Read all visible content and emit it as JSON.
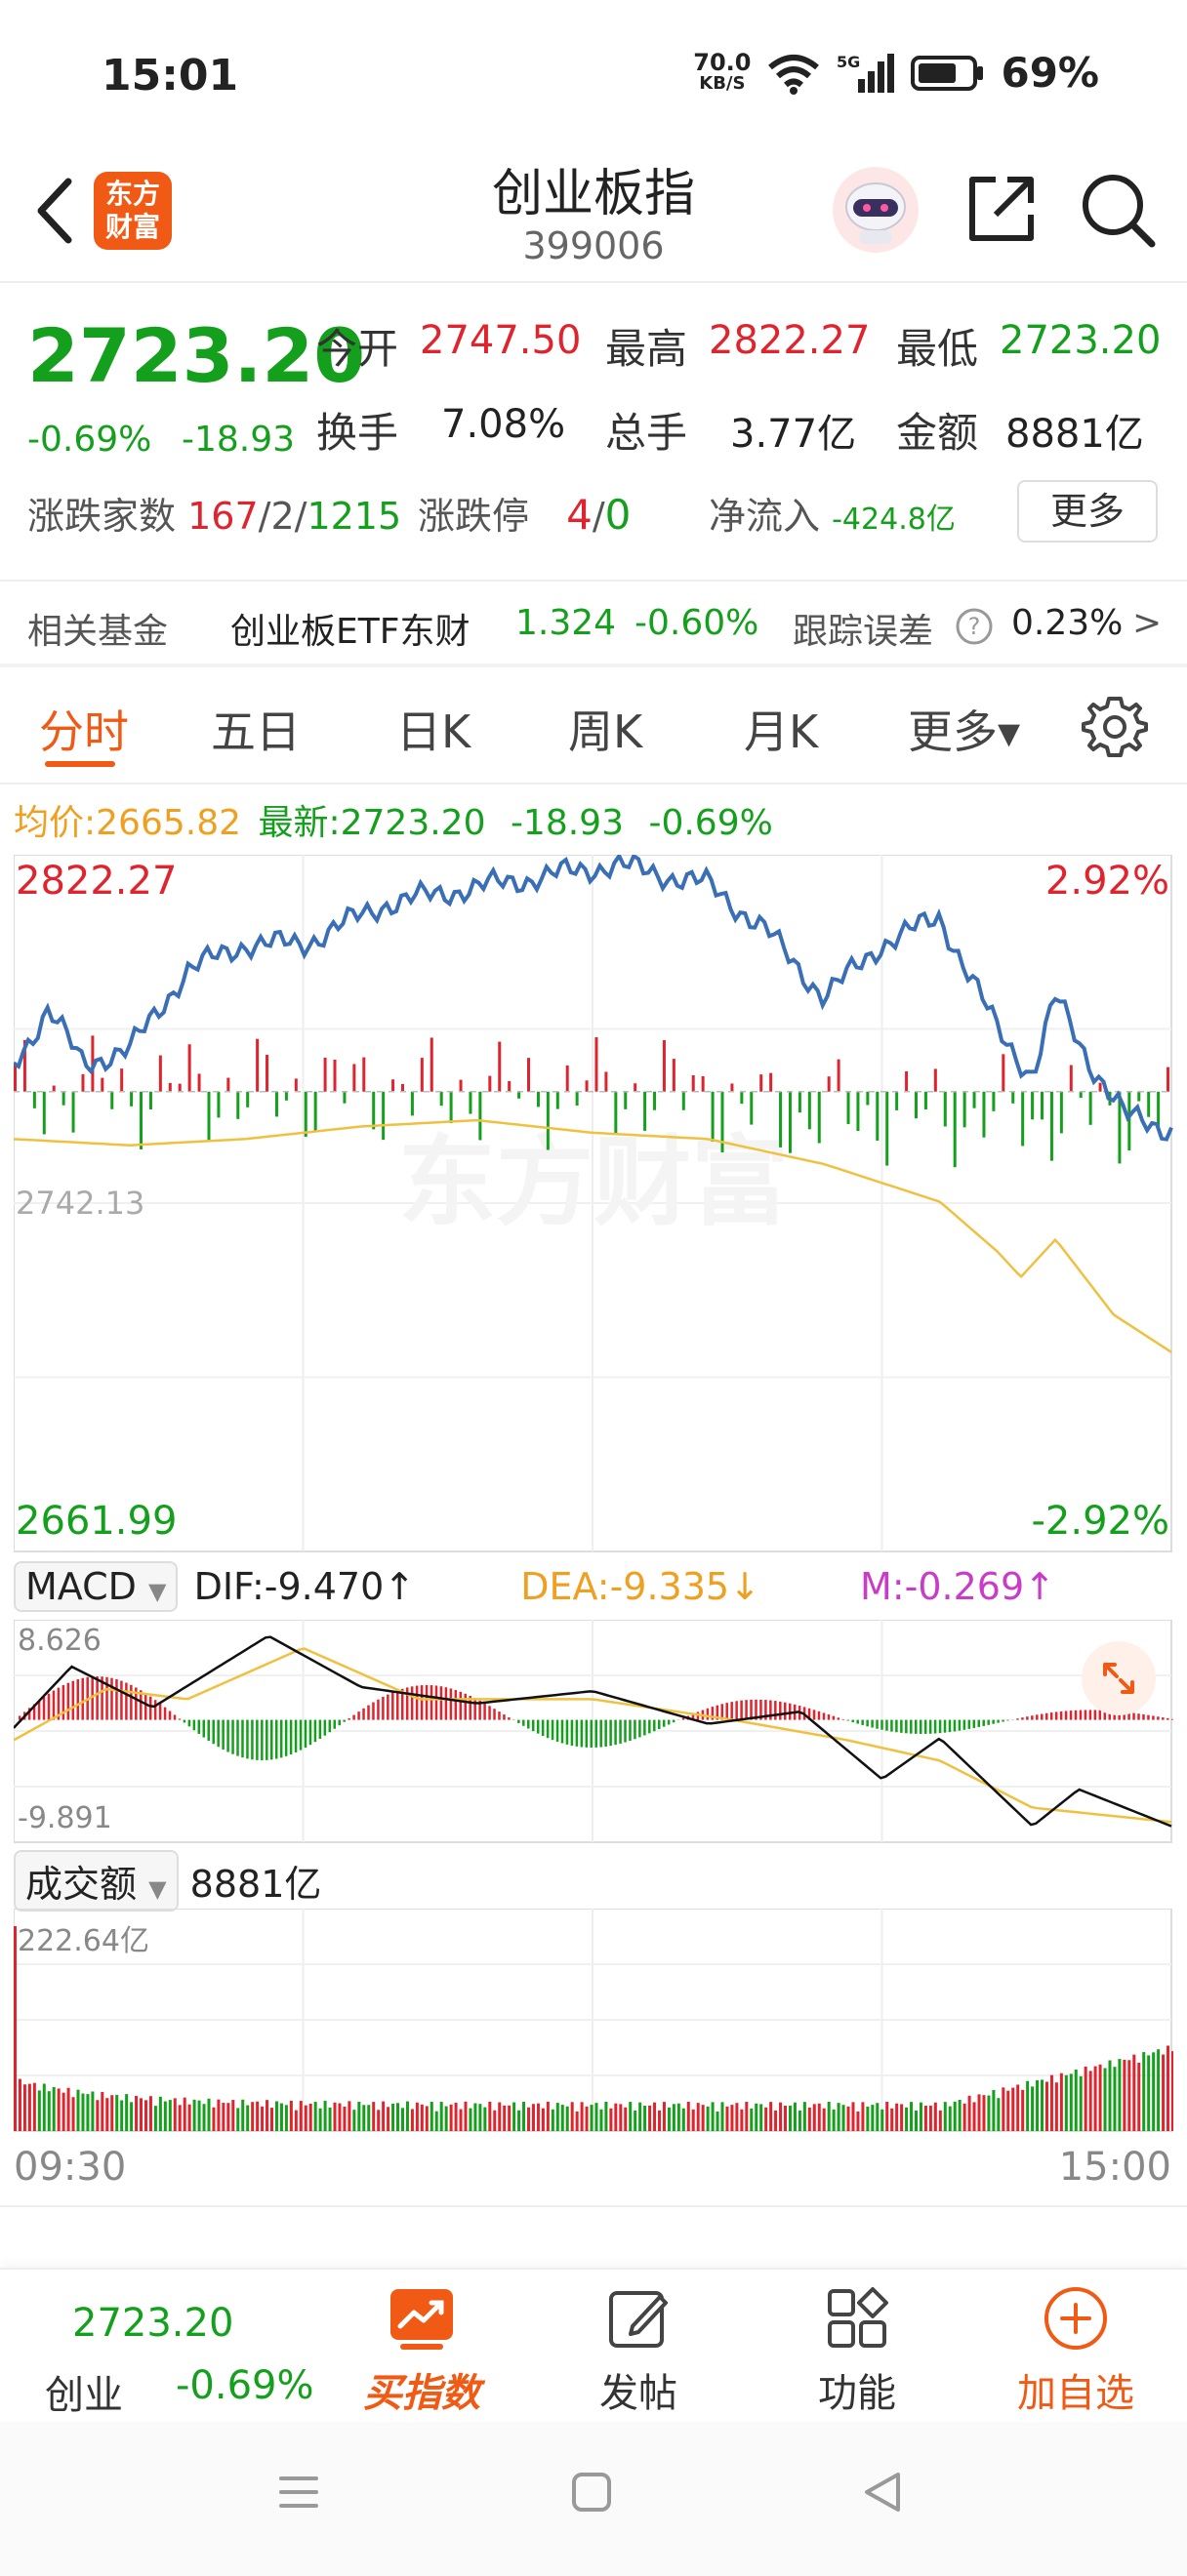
{
  "status_bar": {
    "time": "15:01",
    "net_speed_value": "70.0",
    "net_speed_unit": "KB/S",
    "signal": "5G",
    "battery": "69%"
  },
  "header": {
    "app_logo_top": "东方",
    "app_logo_bottom": "财富",
    "title": "创业板指",
    "code": "399006"
  },
  "quote": {
    "price": "2723.20",
    "change_pct": "-0.69%",
    "change_val": "-18.93",
    "open_label": "今开",
    "open": "2747.50",
    "high_label": "最高",
    "high": "2822.27",
    "low_label": "最低",
    "low": "2723.20",
    "turnover_label": "换手",
    "turnover": "7.08%",
    "volume_label": "总手",
    "volume": "3.77亿",
    "amount_label": "金额",
    "amount": "8881亿",
    "breadth_label": "涨跌家数",
    "breadth_up": "167",
    "breadth_flat": "2",
    "breadth_down": "1215",
    "limit_label": "涨跌停",
    "limit_up": "4",
    "limit_down": "0",
    "netflow_label": "净流入",
    "netflow": "-424.8亿",
    "more_label": "更多"
  },
  "fund": {
    "label": "相关基金",
    "name": "创业板ETF东财",
    "price": "1.324",
    "change": "-0.60%",
    "tracking_label": "跟踪误差",
    "tracking_value": "0.23%",
    "arrow": ">"
  },
  "tabs": [
    {
      "label": "分时",
      "active": true
    },
    {
      "label": "五日"
    },
    {
      "label": "日K"
    },
    {
      "label": "周K"
    },
    {
      "label": "月K"
    },
    {
      "label": "更多▾"
    }
  ],
  "info_line": {
    "avg_label": "均价:",
    "avg": "2665.82",
    "latest_label": "最新:",
    "latest": "2723.20",
    "chg": "-18.93",
    "pct": "-0.69%"
  },
  "main_chart": {
    "y_max_label": "2822.27",
    "y_min_label": "2661.99",
    "pct_max_label": "2.92%",
    "pct_min_label": "-2.92%",
    "watermark": "东方财富",
    "prev_close": "2742.13"
  },
  "macd": {
    "selector": "MACD",
    "dif": "DIF:-9.470↑",
    "dea": "DEA:-9.335↓",
    "m": "M:-0.269↑",
    "max_label": "8.626",
    "min_label": "-9.891"
  },
  "volume": {
    "selector": "成交额",
    "total": "8881亿",
    "max_label": "222.64亿",
    "time_start": "09:30",
    "time_end": "15:00"
  },
  "bottom_nav": {
    "mini_price": "2723.20",
    "mini_name": "创业",
    "mini_pct": "-0.69%",
    "items": [
      {
        "label": "买指数",
        "icon": "chart-up-icon"
      },
      {
        "label": "发帖",
        "icon": "edit-icon"
      },
      {
        "label": "功能",
        "icon": "grid-icon"
      },
      {
        "label": "加自选",
        "icon": "add-circle-icon"
      }
    ]
  },
  "colors": {
    "up": "#e0242e",
    "down": "#14a01c",
    "price_line": "#3a6fb5",
    "avg_line": "#f0c040",
    "accent": "#f05a14"
  }
}
